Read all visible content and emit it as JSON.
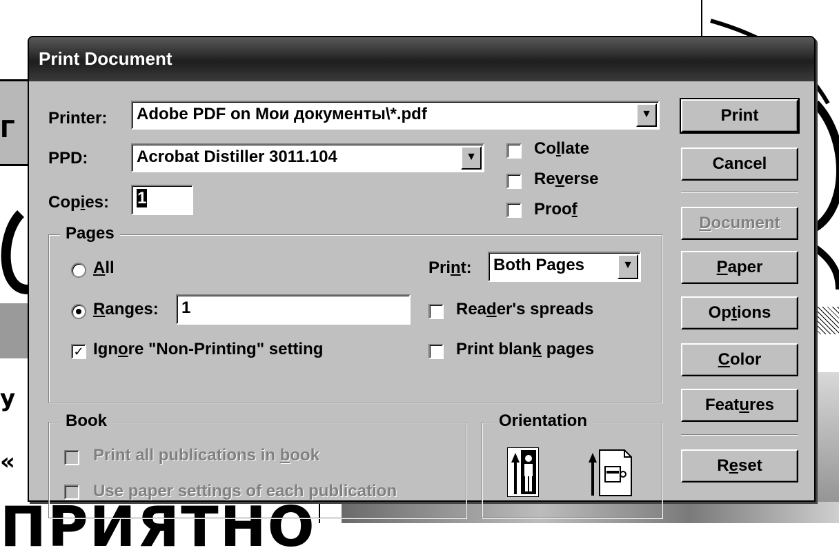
{
  "dialog": {
    "title": "Print Document"
  },
  "printer": {
    "label_pre": "Printer:",
    "value": "Adobe PDF on Мои документы\\*.pdf"
  },
  "ppd": {
    "label": "PPD:",
    "value": "Acrobat Distiller 3011.104"
  },
  "copies": {
    "label_pre": "Cop",
    "label_u": "i",
    "label_post": "es:",
    "value": "1"
  },
  "options": {
    "collate": {
      "pre": "Co",
      "u": "l",
      "post": "late",
      "checked": false
    },
    "reverse": {
      "pre": "Re",
      "u": "v",
      "post": "erse",
      "checked": false
    },
    "proof": {
      "pre": "Proo",
      "u": "f",
      "post": "",
      "checked": false
    }
  },
  "pages": {
    "title": "Pages",
    "all": {
      "pre": "",
      "u": "A",
      "post": "ll",
      "selected": false
    },
    "ranges": {
      "pre": "",
      "u": "R",
      "post": "anges:",
      "selected": true,
      "value": "1"
    },
    "ignore_nonprinting": {
      "pre": "Ign",
      "u": "o",
      "post": "re \"Non-Printing\" setting",
      "checked": true
    },
    "print_label": {
      "pre": "Pri",
      "u": "n",
      "post": "t:"
    },
    "print_value": "Both Pages",
    "readers_spreads": {
      "pre": "Rea",
      "u": "d",
      "post": "er's spreads",
      "checked": false
    },
    "print_blank": {
      "pre": "Print blan",
      "u": "k",
      "post": " pages",
      "checked": false
    }
  },
  "book": {
    "title": "Book",
    "print_all": {
      "pre": "Print all publications in ",
      "u": "b",
      "post": "ook",
      "checked": false
    },
    "use_paper": {
      "pre": "Use paper settin",
      "u": "g",
      "post": "s of each publication",
      "checked": false
    }
  },
  "orientation": {
    "title": "Orientation",
    "icons": [
      "portrait-orientation-icon",
      "landscape-orientation-icon"
    ]
  },
  "buttons": {
    "print": "Print",
    "cancel": "Cancel",
    "document": {
      "pre": "",
      "u": "D",
      "post": "ocument"
    },
    "paper": {
      "pre": "",
      "u": "P",
      "post": "aper"
    },
    "options": {
      "pre": "Op",
      "u": "t",
      "post": "ions"
    },
    "color": {
      "pre": "",
      "u": "C",
      "post": "olor"
    },
    "features": {
      "pre": "Feat",
      "u": "u",
      "post": "res"
    },
    "reset": {
      "pre": "R",
      "u": "e",
      "post": "set"
    }
  },
  "background": {
    "big_text": "ПРИЯТНО",
    "side_letters": [
      "Г",
      "у",
      "«"
    ]
  },
  "colors": {
    "dialog_face": "#c0c0c0",
    "titlebar": "#1e1e1e",
    "disabled_text": "#808080"
  }
}
